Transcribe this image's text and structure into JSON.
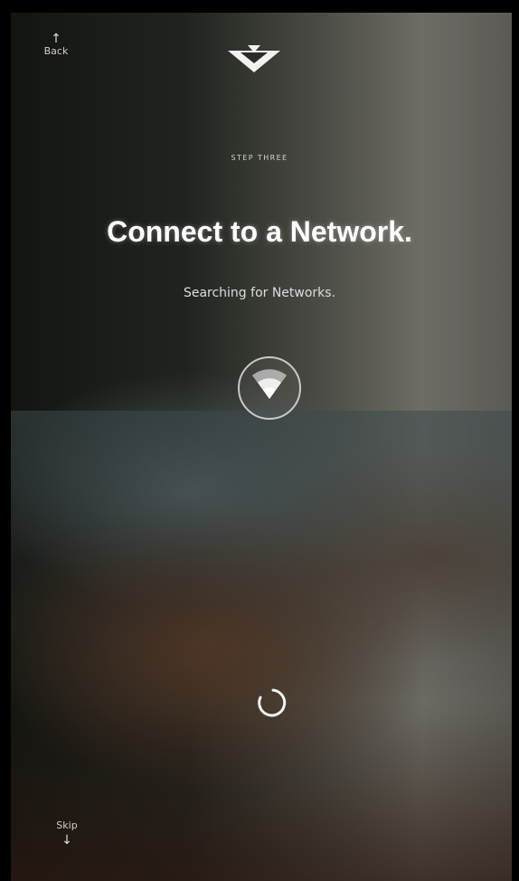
{
  "header": {
    "back_label": "Back",
    "back_icon": "up-arrow-icon",
    "logo_icon": "vizio-v-logo-icon"
  },
  "setup": {
    "step_label": "STEP THREE",
    "title": "Connect to a Network.",
    "status": "Searching for Networks."
  },
  "indicators": {
    "wifi_icon": "wifi-icon",
    "spinner_icon": "loading-spinner-icon"
  },
  "footer": {
    "skip_label": "Skip",
    "skip_icon": "down-arrow-icon"
  },
  "colors": {
    "text": "#ffffff",
    "frame": "#000000"
  }
}
